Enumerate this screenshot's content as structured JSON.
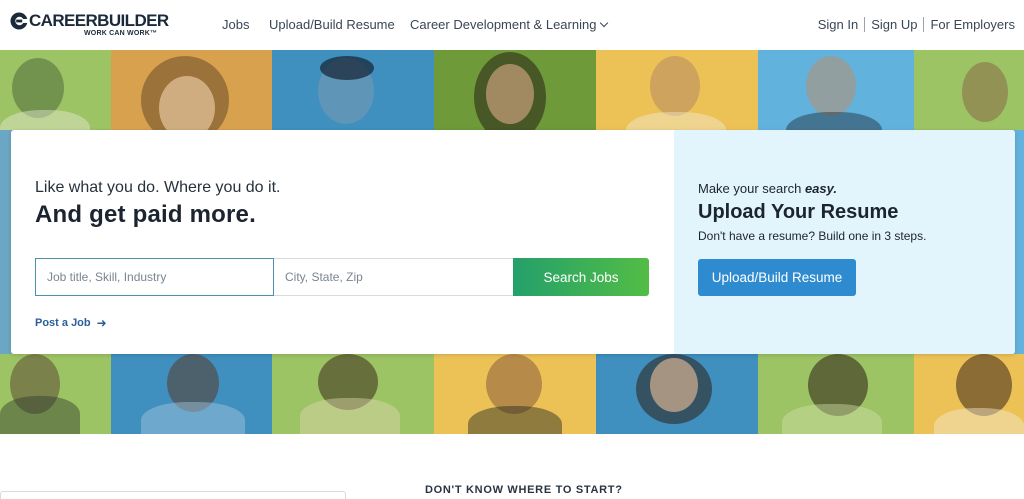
{
  "header": {
    "logo_name": "CAREERBUILDER",
    "logo_tagline": "WORK CAN WORK™",
    "nav": {
      "jobs": "Jobs",
      "upload": "Upload/Build Resume",
      "career": "Career Development & Learning"
    },
    "sign_in": "Sign In",
    "sign_up": "Sign Up",
    "employers": "For Employers"
  },
  "hero": {
    "tagline": "Like what you do. Where you do it.",
    "headline": "And get paid more.",
    "job_placeholder": "Job title, Skill, Industry",
    "job_value": "",
    "location_placeholder": "City, State, Zip",
    "location_value": "",
    "search_button": "Search Jobs",
    "post_job": "Post a Job",
    "resume": {
      "make_search": "Make your search",
      "easy": "easy.",
      "title": "Upload Your Resume",
      "subtitle": "Don't have a resume? Build one in 3 steps.",
      "button": "Upload/Build Resume"
    }
  },
  "bottom": {
    "dont_know": "DON'T KNOW WHERE TO START?"
  },
  "colors": {
    "search_green_start": "#24a06b",
    "search_green_end": "#52bd45",
    "upload_blue": "#2f8bd0",
    "resume_panel_bg": "#e3f5fc",
    "tile_green": "#9dc464",
    "tile_orange": "#d8a14e",
    "tile_blue": "#3f8fbf",
    "tile_yellow": "#ecc257",
    "tile_lightblue": "#62b2de"
  }
}
